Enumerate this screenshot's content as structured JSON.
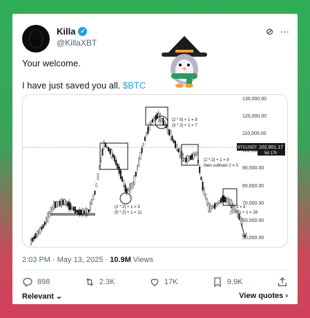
{
  "user": {
    "name": "Killa",
    "handle": "@KillaXBT"
  },
  "tweet": {
    "line1": "Your welcome.",
    "line2": "I have just saved you all.",
    "cashtag": "$BTC"
  },
  "chart": {
    "y_ticks": [
      "130,000.00",
      "120,000.00",
      "110,000.00",
      "100,000.00",
      "90,000.00",
      "80,000.00",
      "70,000.00",
      "60,000.00",
      "50,000.00"
    ],
    "price_label": "102,601.17",
    "symbol": "BTCUSDT",
    "time_label": "5d 17h",
    "ann1_a": "(2 * 5) + 1 = 9",
    "ann1_b": "(3 * 2) + 1 = 7",
    "ann2_a": "(2 * 2) + 1 = 5",
    "ann2_b": "then subtract 2 = 3",
    "ann3_a": "(2 * 2) + 1 = 5",
    "ann3_b": "(5 * 2) + 1 = 11",
    "ann4_a": "4 * 2 = 8",
    "ann4_b": "(5 * 5) + 1 = 26"
  },
  "meta": {
    "time": "2:03 PM · May 13, 2025 · ",
    "views": "10.9M",
    "views_label": " Views"
  },
  "actions": {
    "replies": "898",
    "retweets": "2.3K",
    "likes": "17K",
    "bookmarks": "9.9K"
  },
  "footer": {
    "relevant": "Relevant",
    "view_quotes": "View quotes"
  }
}
